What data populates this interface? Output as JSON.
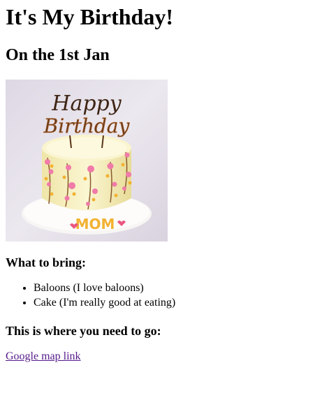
{
  "title": "It's My Birthday!",
  "date": "On the 1st Jan",
  "image": {
    "topper_line1": "Happy",
    "topper_line2": "Birthday",
    "cake_text": "MOM",
    "colors": {
      "background": "#e7e3ec",
      "cream": "#f6efbf",
      "topper": "#4a2a16",
      "letters": "#f2b233",
      "flowers": "#f07aa8"
    }
  },
  "bring_heading": "What to bring:",
  "bring_items": [
    "Baloons (I love baloons)",
    "Cake (I'm really good at eating)"
  ],
  "where_heading": "This is where you need to go:",
  "map_link": "Google map link"
}
